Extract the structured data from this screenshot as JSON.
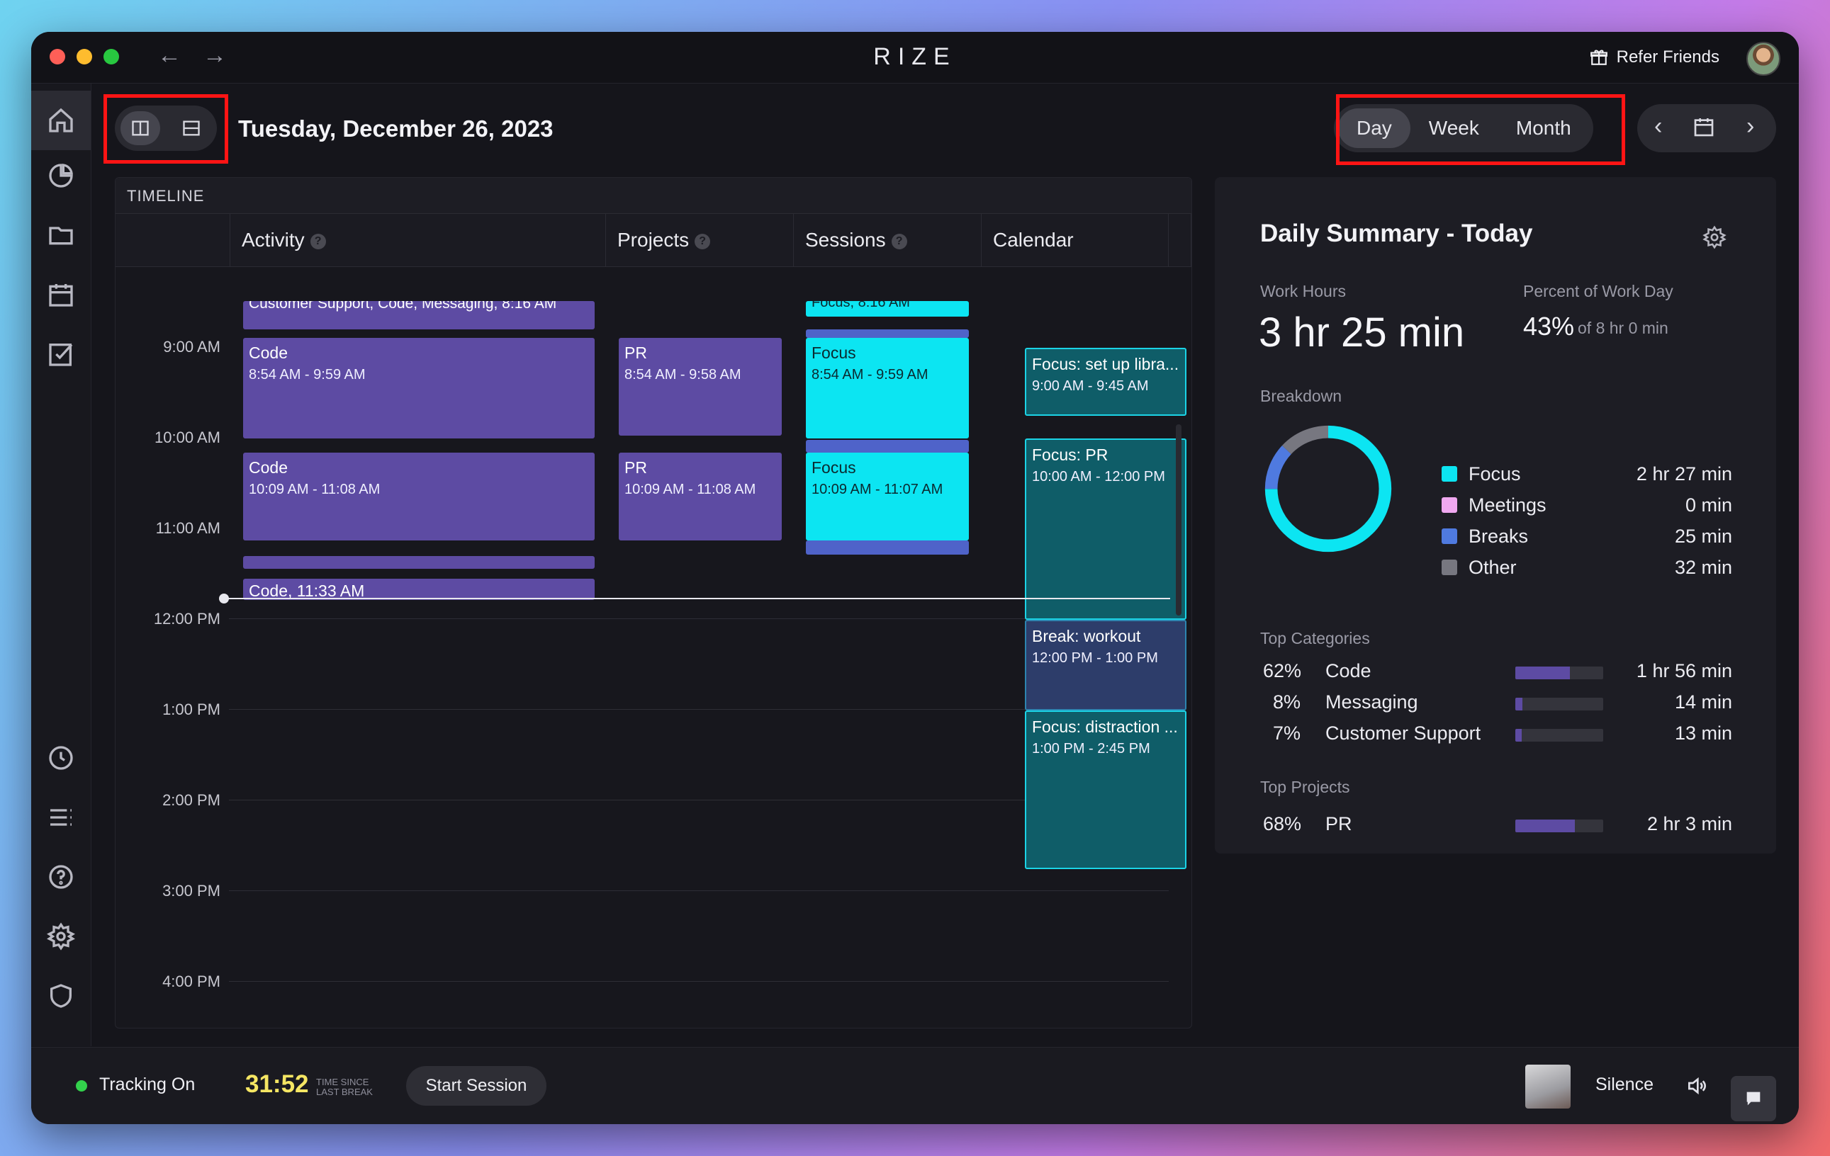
{
  "window": {
    "logo": "RIZE",
    "refer_friends": "Refer Friends",
    "back_icon": "←",
    "forward_icon": "→"
  },
  "header": {
    "date": "Tuesday, December 26, 2023",
    "ranges": [
      "Day",
      "Week",
      "Month"
    ],
    "active_range": "Day"
  },
  "timeline": {
    "title": "TIMELINE",
    "columns": [
      "Activity",
      "Projects",
      "Sessions",
      "Calendar"
    ],
    "hours": [
      "9:00 AM",
      "10:00 AM",
      "11:00 AM",
      "12:00 PM",
      "1:00 PM",
      "2:00 PM",
      "3:00 PM",
      "4:00 PM"
    ],
    "activity": {
      "top_partial": "Customer Support, Code, Messaging, 8:16 AM",
      "block1_title": "Code",
      "block1_time": "8:54 AM - 9:59 AM",
      "block2_title": "Code",
      "block2_time": "10:09 AM - 11:08 AM",
      "current": "Code, 11:33 AM"
    },
    "projects": {
      "block1_title": "PR",
      "block1_time": "8:54 AM - 9:58 AM",
      "block2_title": "PR",
      "block2_time": "10:09 AM - 11:08 AM"
    },
    "sessions": {
      "top_partial": "Focus, 8:16 AM",
      "block1_title": "Focus",
      "block1_time": "8:54 AM - 9:59 AM",
      "block2_title": "Focus",
      "block2_time": "10:09 AM - 11:07 AM"
    },
    "calendar": {
      "ev1_title": "Focus: set up libra...",
      "ev1_time": "9:00 AM - 9:45 AM",
      "ev2_title": "Focus: PR",
      "ev2_time": "10:00 AM - 12:00 PM",
      "ev3_title": "Break: workout",
      "ev3_time": "12:00 PM - 1:00 PM",
      "ev4_title": "Focus: distraction ...",
      "ev4_time": "1:00 PM - 2:45 PM"
    }
  },
  "summary": {
    "title": "Daily Summary - Today",
    "work_hours_label": "Work Hours",
    "work_hours": "3 hr 25 min",
    "percent_label": "Percent of Work Day",
    "percent": "43%",
    "percent_of": "of 8 hr 0 min",
    "breakdown_label": "Breakdown",
    "breakdown": [
      {
        "name": "Focus",
        "value": "2 hr 27 min",
        "color": "#0ce5f2"
      },
      {
        "name": "Meetings",
        "value": "0 min",
        "color": "#f0a8f0"
      },
      {
        "name": "Breaks",
        "value": "25 min",
        "color": "#4f7ae0"
      },
      {
        "name": "Other",
        "value": "32 min",
        "color": "#777780"
      }
    ],
    "top_categories_label": "Top Categories",
    "categories": [
      {
        "pct": "62%",
        "name": "Code",
        "duration": "1 hr 56 min",
        "fill": 0.62
      },
      {
        "pct": "8%",
        "name": "Messaging",
        "duration": "14 min",
        "fill": 0.08
      },
      {
        "pct": "7%",
        "name": "Customer Support",
        "duration": "13 min",
        "fill": 0.07
      }
    ],
    "top_projects_label": "Top Projects",
    "projects": [
      {
        "pct": "68%",
        "name": "PR",
        "duration": "2 hr 3 min",
        "fill": 0.68
      }
    ]
  },
  "footer": {
    "tracking": "Tracking On",
    "timer": "31:52",
    "since_line1": "TIME SINCE",
    "since_line2": "LAST BREAK",
    "start_session": "Start Session",
    "music": "Silence"
  }
}
